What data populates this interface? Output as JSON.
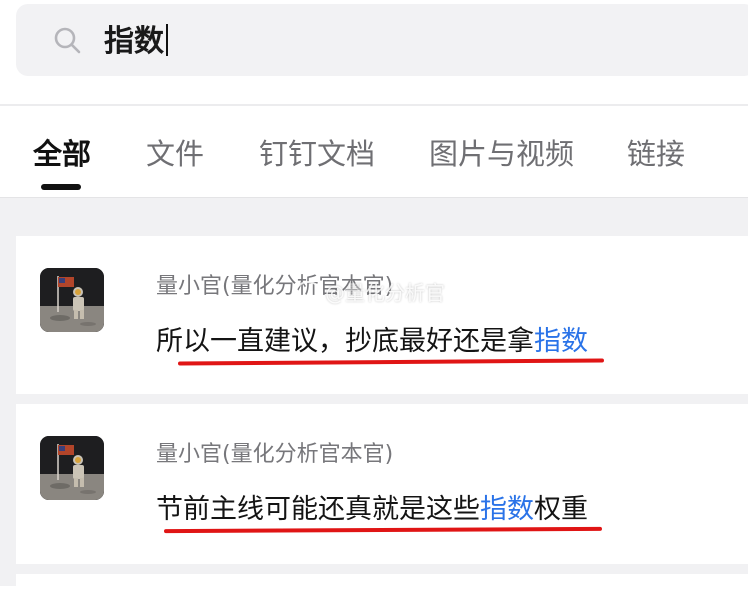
{
  "search": {
    "query": "指数"
  },
  "tabs": [
    {
      "label": "全部",
      "active": true
    },
    {
      "label": "文件",
      "active": false
    },
    {
      "label": "钉钉文档",
      "active": false
    },
    {
      "label": "图片与视频",
      "active": false
    },
    {
      "label": "链接",
      "active": false
    }
  ],
  "results": [
    {
      "author": "量小官(量化分析官本官)",
      "snippet_before": "所以一直建议，抄底最好还是拿",
      "snippet_highlight": "指数",
      "snippet_after": ""
    },
    {
      "author": "量小官(量化分析官本官)",
      "snippet_before": "节前主线可能还真就是这些",
      "snippet_highlight": "指数",
      "snippet_after": "权重"
    }
  ],
  "watermark": {
    "text": "@量化分析官"
  },
  "colors": {
    "highlight": "#2a73e8",
    "annotation": "#e01515",
    "page_bg": "#f1f1f3"
  }
}
